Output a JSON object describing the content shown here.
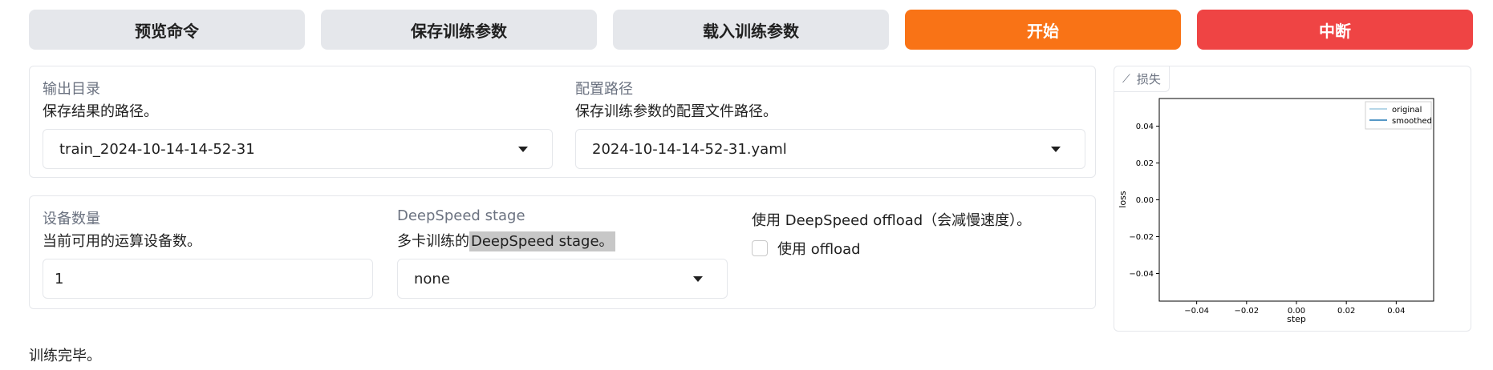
{
  "buttons": {
    "preview": "预览命令",
    "save": "保存训练参数",
    "load": "载入训练参数",
    "start": "开始",
    "abort": "中断"
  },
  "colors": {
    "start_bg": "#f97316",
    "abort_bg": "#ef4444",
    "neutral_bg": "#e5e7eb"
  },
  "output_dir": {
    "label": "输出目录",
    "info": "保存结果的路径。",
    "value": "train_2024-10-14-14-52-31"
  },
  "config_path": {
    "label": "配置路径",
    "info": "保存训练参数的配置文件路径。",
    "value": "2024-10-14-14-52-31.yaml"
  },
  "device_count": {
    "label": "设备数量",
    "info": "当前可用的运算设备数。",
    "value": "1"
  },
  "ds_stage": {
    "label": "DeepSpeed stage",
    "info_prefix": "多卡训练的",
    "info_highlight": "DeepSpeed stage。",
    "value": "none"
  },
  "ds_offload": {
    "info": "使用 DeepSpeed offload（会减慢速度）。",
    "checkbox_label": "使用 offload",
    "checked": false
  },
  "plot": {
    "tab_label": "损失",
    "tab_icon": "chart-icon"
  },
  "chart_data": {
    "type": "line",
    "xlabel": "step",
    "ylabel": "loss",
    "xticks": [
      "−0.04",
      "−0.02",
      "0.00",
      "0.02",
      "0.04"
    ],
    "yticks": [
      "0.04",
      "0.02",
      "0.00",
      "−0.02",
      "−0.04"
    ],
    "xlim": [
      -0.055,
      0.055
    ],
    "ylim": [
      -0.055,
      0.055
    ],
    "series": [
      {
        "name": "original",
        "color": "#9ecae1",
        "x": [],
        "y": []
      },
      {
        "name": "smoothed",
        "color": "#1f77b4",
        "x": [],
        "y": []
      }
    ],
    "legend": "top-right"
  },
  "status": "训练完毕。"
}
